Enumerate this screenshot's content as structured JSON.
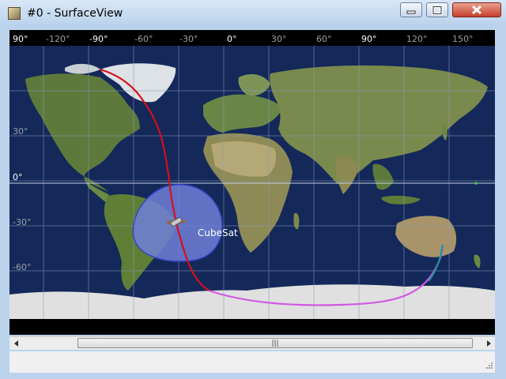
{
  "window": {
    "title": "#0 - SurfaceView",
    "icons": {
      "app": "map-app-icon",
      "minimize": "minimize-icon",
      "maximize": "maximize-icon",
      "close": "close-icon"
    }
  },
  "map": {
    "lon_labels": [
      "90°",
      "-120°",
      "-90°",
      "-60°",
      "-30°",
      "0°",
      "30°",
      "60°",
      "90°",
      "120°",
      "150°"
    ],
    "lat_labels": [
      "30°",
      "0°",
      "-30°",
      "-60°"
    ],
    "satellite": {
      "name": "CubeSat",
      "icon": "satellite-icon"
    },
    "colors": {
      "ocean": "#14285a",
      "land": "#6f8a4a",
      "ice": "#dcdcdc",
      "grid": "#8a9bb8",
      "ground_track_past": "#d4101a",
      "ground_track_future": "#d05ae0",
      "footprint": "#6f7fd8"
    }
  },
  "scrollbar": {
    "thumb_glyph": "|||"
  }
}
